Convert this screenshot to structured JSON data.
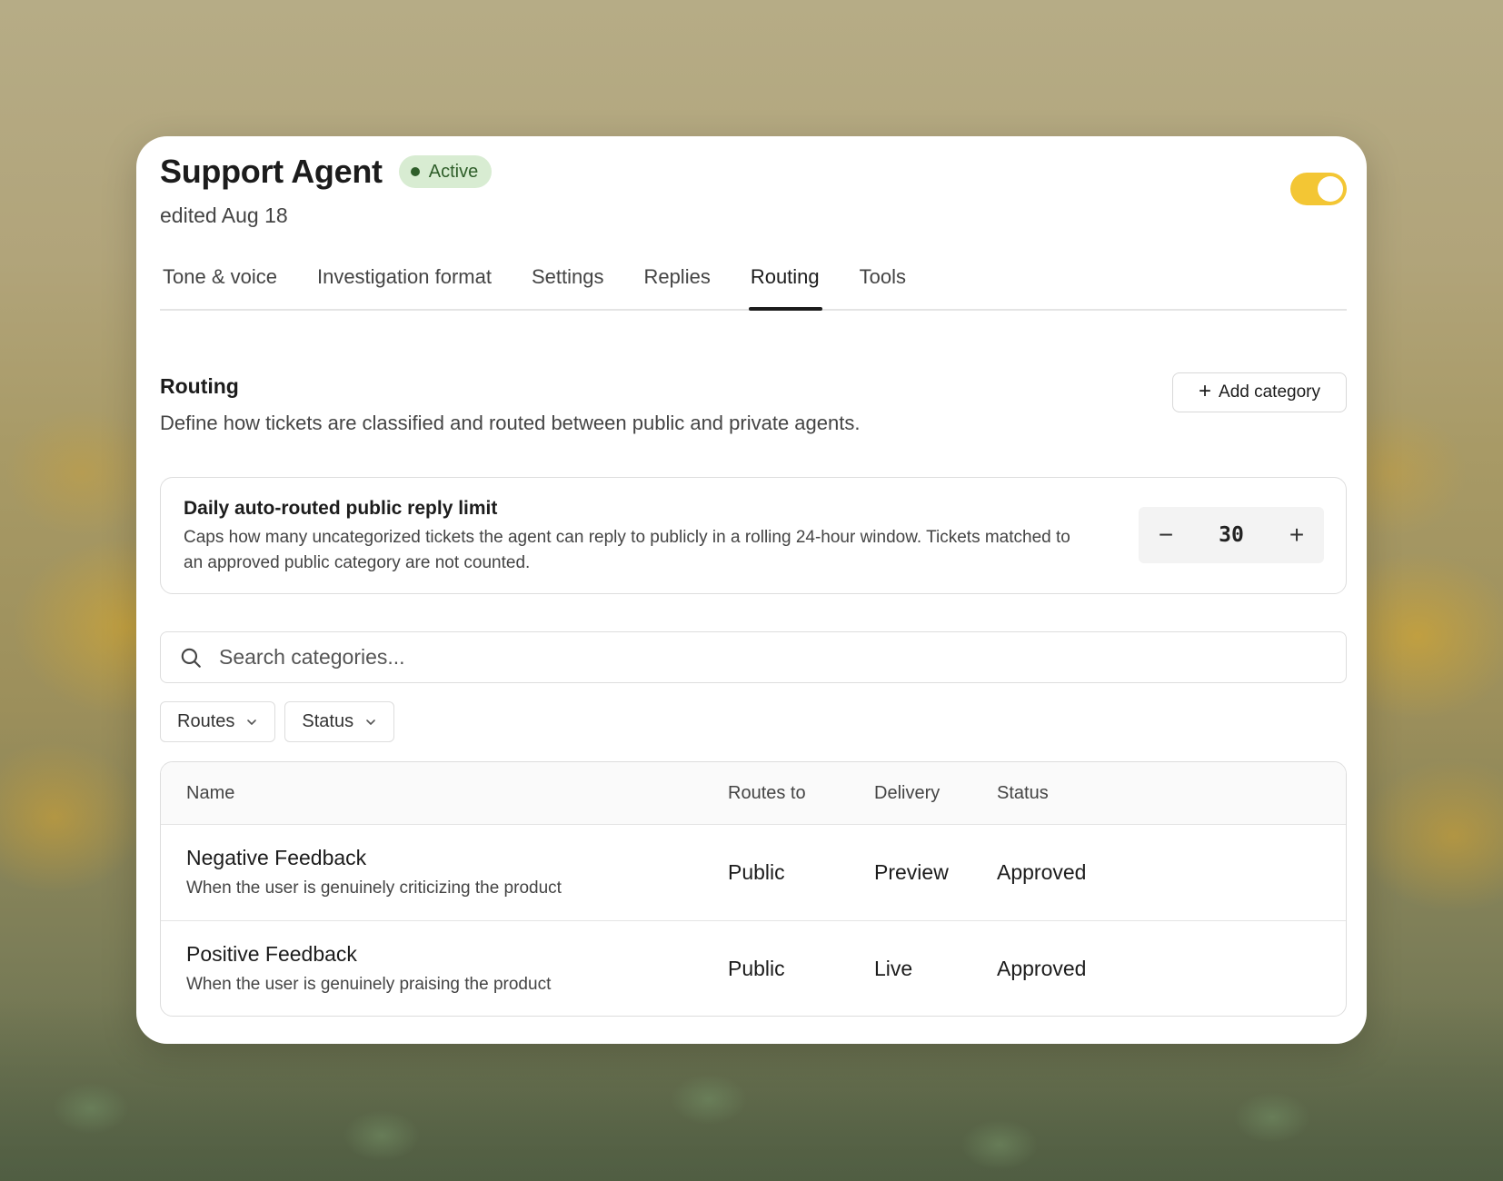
{
  "agent": {
    "name": "Support Agent",
    "status_badge": "Active",
    "edited": "edited Aug 18",
    "enabled": true
  },
  "tabs": [
    {
      "label": "Tone & voice",
      "active": false
    },
    {
      "label": "Investigation format",
      "active": false
    },
    {
      "label": "Settings",
      "active": false
    },
    {
      "label": "Replies",
      "active": false
    },
    {
      "label": "Routing",
      "active": true
    },
    {
      "label": "Tools",
      "active": false
    }
  ],
  "routing": {
    "title": "Routing",
    "description": "Define how tickets are classified and routed between public and private agents.",
    "add_category_label": "Add category"
  },
  "limit": {
    "title": "Daily auto-routed public reply limit",
    "description": "Caps how many uncategorized tickets the agent can reply to publicly in a rolling 24-hour window. Tickets matched to an approved public category are not counted.",
    "value": "30",
    "decrement": "−",
    "increment": "+"
  },
  "search": {
    "placeholder": "Search categories...",
    "value": ""
  },
  "filters": [
    {
      "label": "Routes"
    },
    {
      "label": "Status"
    }
  ],
  "table": {
    "columns": [
      "Name",
      "Routes to",
      "Delivery",
      "Status"
    ],
    "rows": [
      {
        "name": "Negative Feedback",
        "description": "When the user is genuinely criticizing the product",
        "routes_to": "Public",
        "delivery": "Preview",
        "status": "Approved"
      },
      {
        "name": "Positive Feedback",
        "description": "When the user is genuinely praising the product",
        "routes_to": "Public",
        "delivery": "Live",
        "status": "Approved"
      }
    ]
  },
  "colors": {
    "toggle_on": "#f3c634",
    "badge_bg": "#d8ecd2",
    "badge_text": "#2f5e2a"
  }
}
